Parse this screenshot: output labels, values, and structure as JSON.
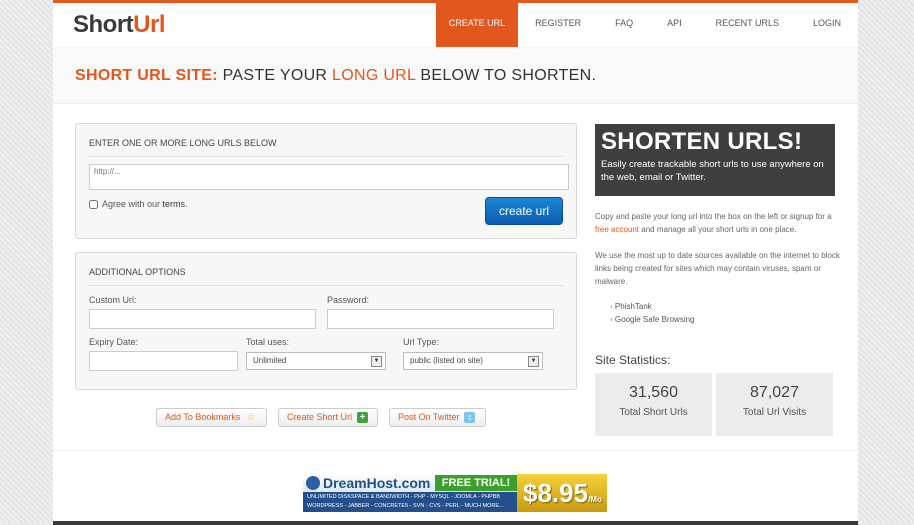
{
  "header": {
    "logo": {
      "main": "Short",
      "accent": "Url"
    },
    "nav": [
      {
        "label": "CREATE URL",
        "active": true
      },
      {
        "label": "REGISTER",
        "active": false
      },
      {
        "label": "FAQ",
        "active": false
      },
      {
        "label": "API",
        "active": false
      },
      {
        "label": "RECENT URLS",
        "active": false
      },
      {
        "label": "LOGIN",
        "active": false
      }
    ]
  },
  "title": {
    "part1": "SHORT URL SITE:",
    "part2": " PASTE YOUR ",
    "part3": "LONG URL",
    "part4": " BELOW TO SHORTEN."
  },
  "url_box": {
    "heading": "ENTER ONE OR MORE LONG URLS BELOW",
    "placeholder": "http://...",
    "agree_text": "Agree with our ",
    "terms_link": "terms",
    "agree_end": ".",
    "create_button": "create url"
  },
  "options": {
    "heading": "ADDITIONAL OPTIONS",
    "custom_url_label": "Custom Url:",
    "password_label": "Password:",
    "expiry_label": "Expiry Date:",
    "total_uses_label": "Total uses:",
    "total_uses_value": "Unlimited",
    "url_type_label": "Url Type:",
    "url_type_value": "public (listed on site)"
  },
  "actions": [
    {
      "label": "Add To Bookmarks",
      "icon": "star-icon"
    },
    {
      "label": "Create Short Url",
      "icon": "plus-icon"
    },
    {
      "label": "Post On Twitter",
      "icon": "twitter-icon"
    }
  ],
  "promo": {
    "heading": "SHORTEN URLS!",
    "text": "Easily create trackable short urls to use anywhere on the web, email or Twitter."
  },
  "sidebar": {
    "para1_before": "Copy and paste your long url into the box on the left or signup for a ",
    "para1_link": "free account",
    "para1_after": " and manage all your short urls in one place.",
    "para2": "We use the most up to date sources available on the internet to block links being created for sites which may contain viruses, spam or malware.",
    "sources": [
      "PhishTank",
      "Google Safe Browsing"
    ],
    "stats_title": "Site Statistics:",
    "stats": [
      {
        "value": "31,560",
        "label": "Total Short Urls"
      },
      {
        "value": "87,027",
        "label": "Total Url Visits"
      }
    ]
  },
  "ad": {
    "brand": "DreamHost.com",
    "trial": "FREE TRIAL!",
    "features": "UNLIMITED DISKSPACE & BANDWIDTH - PHP - MYSQL - JOOMLA - PHPBB WORDPRESS - JABBER - CONCRETE5 - SVN - CVS - PERL - MUCH MORE...",
    "price": "$8.95",
    "per": "/Mo"
  },
  "colors": {
    "accent": "#e2571e",
    "button_blue": "#0b5cb1",
    "promo_bg": "#3f3f3f"
  }
}
